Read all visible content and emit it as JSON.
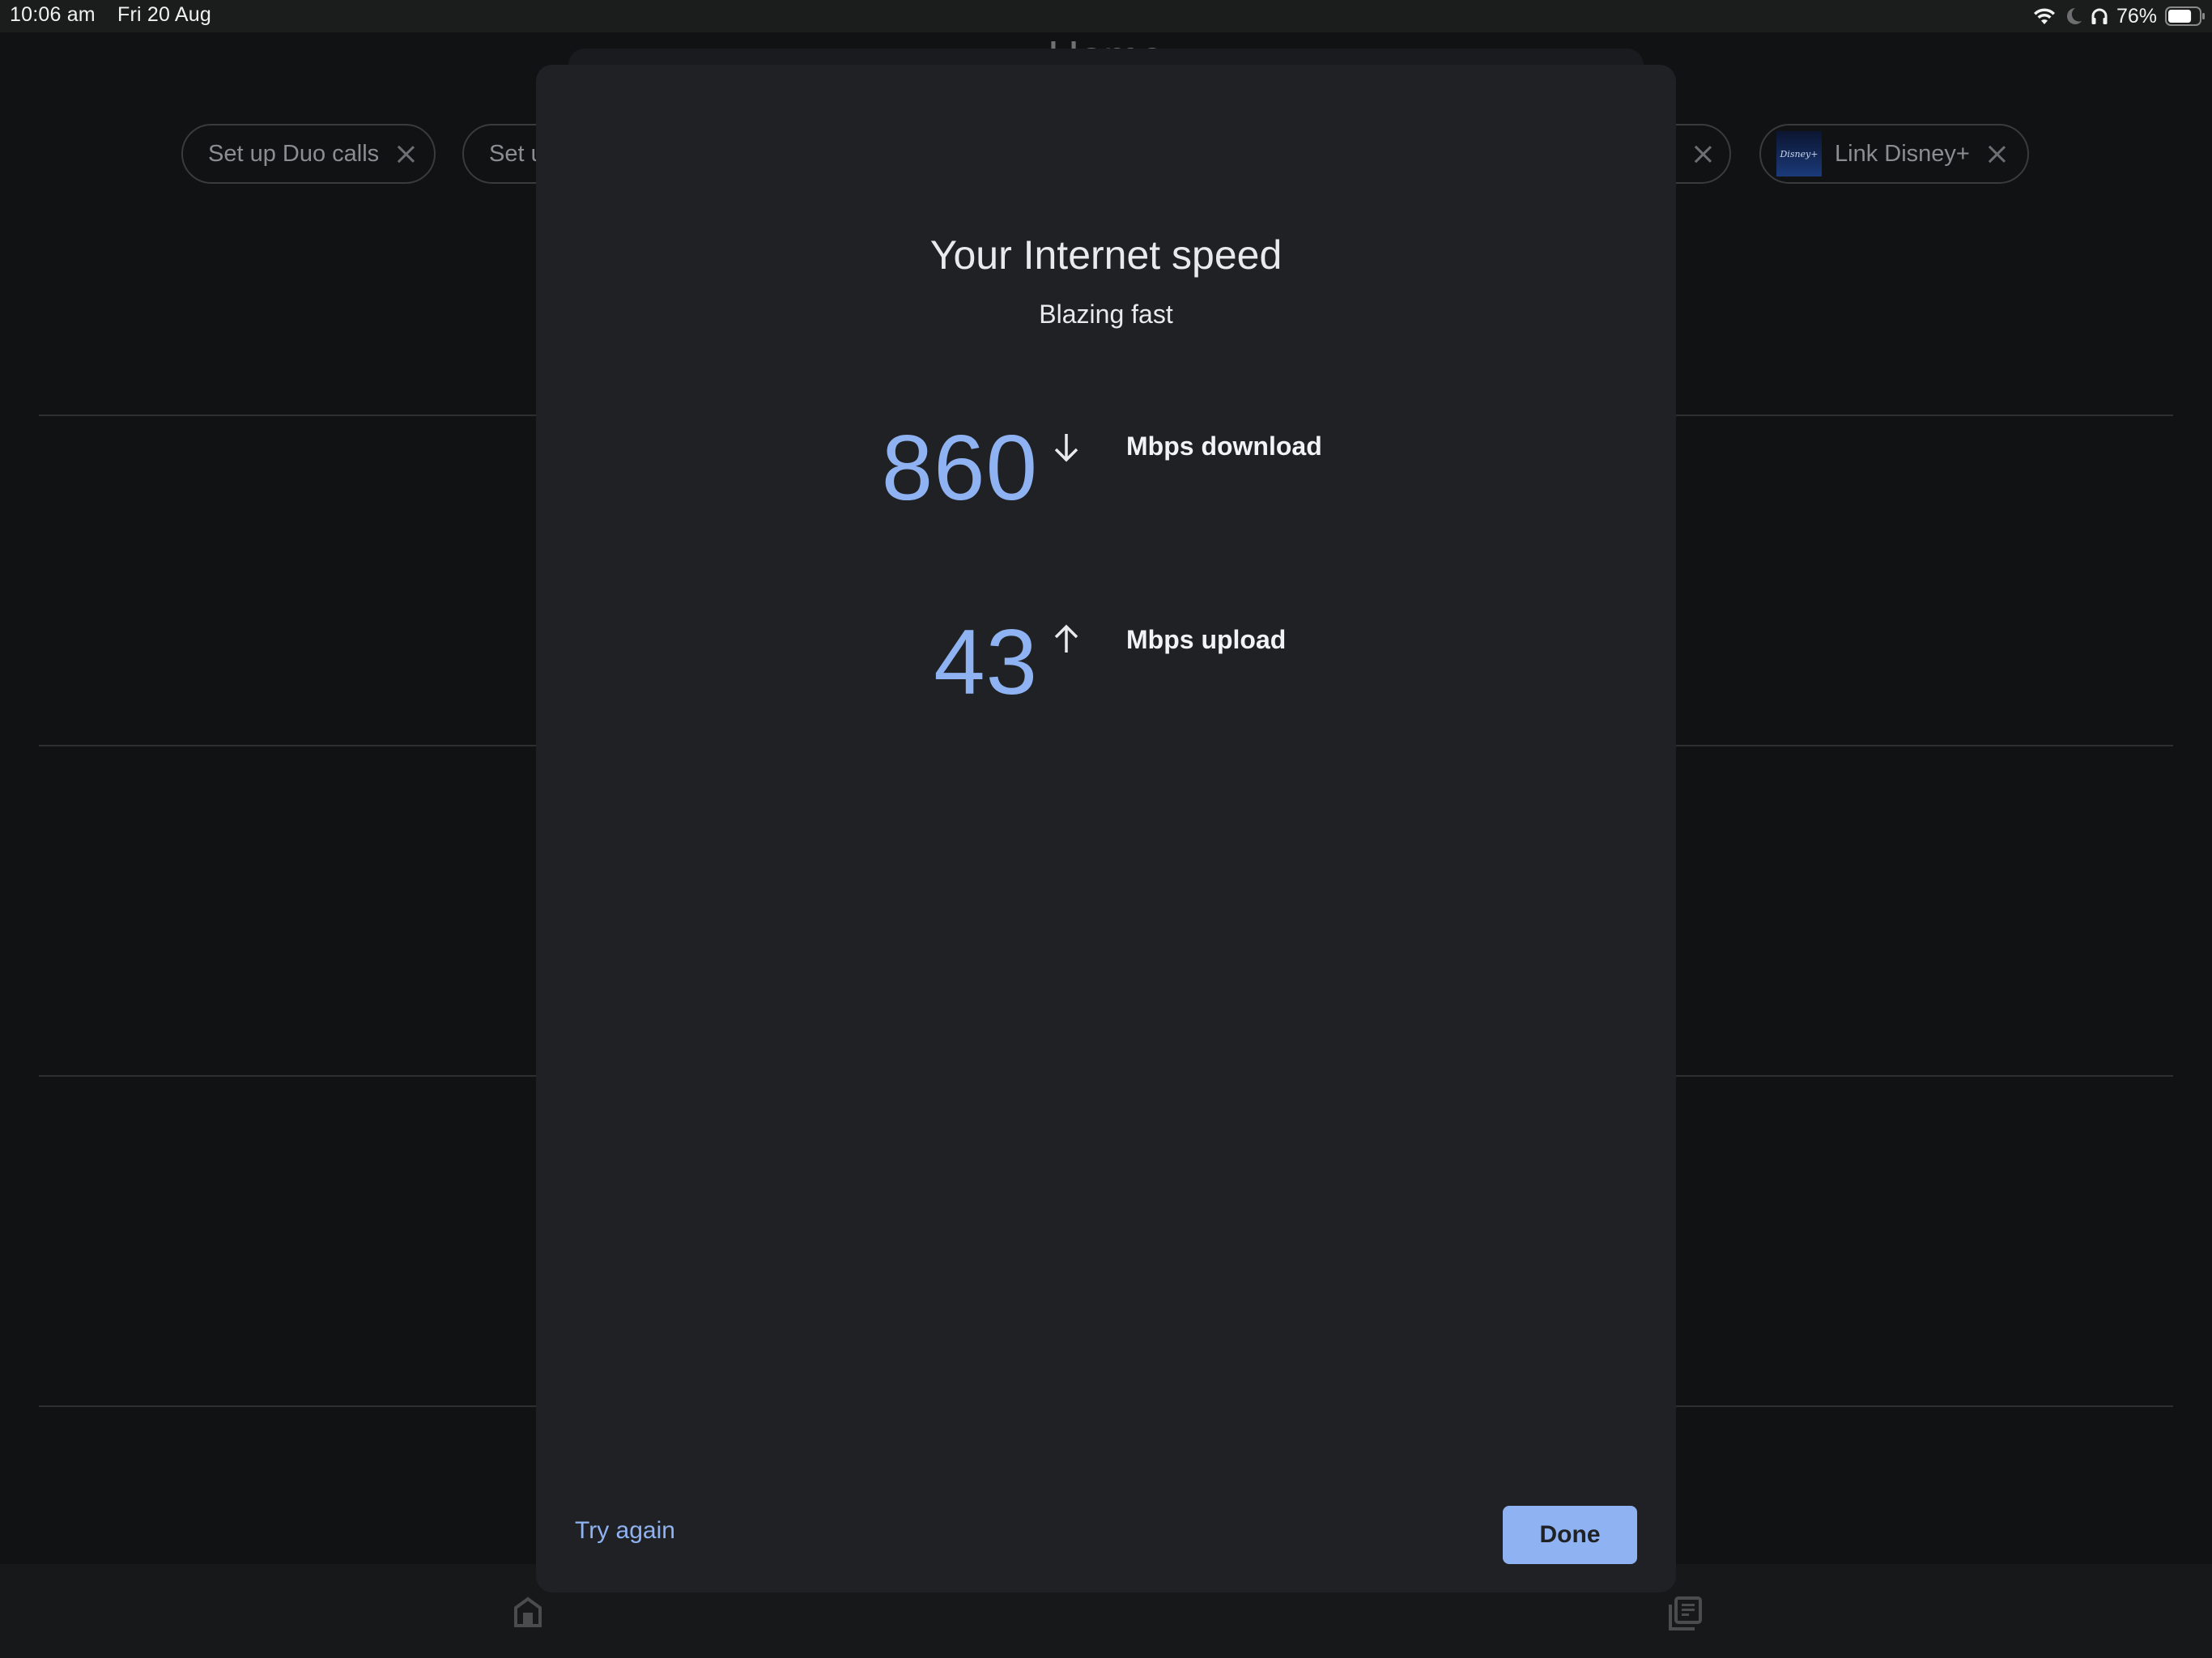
{
  "status_bar": {
    "time": "10:06 am",
    "date": "Fri 20 Aug",
    "battery_percent": "76%",
    "battery_level": 0.76,
    "icons": [
      "wifi-icon",
      "do-not-disturb-moon-icon",
      "headphones-icon",
      "battery-icon"
    ]
  },
  "background": {
    "page_title": "Home",
    "chips": [
      {
        "label": "Set up Duo calls",
        "icon": "close-icon"
      },
      {
        "label": "Set u",
        "icon": "close-icon"
      },
      {
        "label": "",
        "icon": "close-icon"
      },
      {
        "label": "Link Disney+",
        "logo": "Disney+",
        "icon": "close-icon"
      }
    ],
    "bottom_nav": [
      {
        "name": "home",
        "icon": "home-icon"
      },
      {
        "name": "feed",
        "icon": "library-icon"
      }
    ]
  },
  "dialog": {
    "title": "Your Internet speed",
    "subtitle": "Blazing fast",
    "download": {
      "value": "860",
      "unit_label": "Mbps download",
      "icon": "arrow-down-icon"
    },
    "upload": {
      "value": "43",
      "unit_label": "Mbps upload",
      "icon": "arrow-up-icon"
    },
    "secondary_action": "Try again",
    "primary_action": "Done"
  },
  "colors": {
    "accent": "#8fb3f2",
    "sheet_bg": "#202124",
    "page_bg": "#111214"
  }
}
